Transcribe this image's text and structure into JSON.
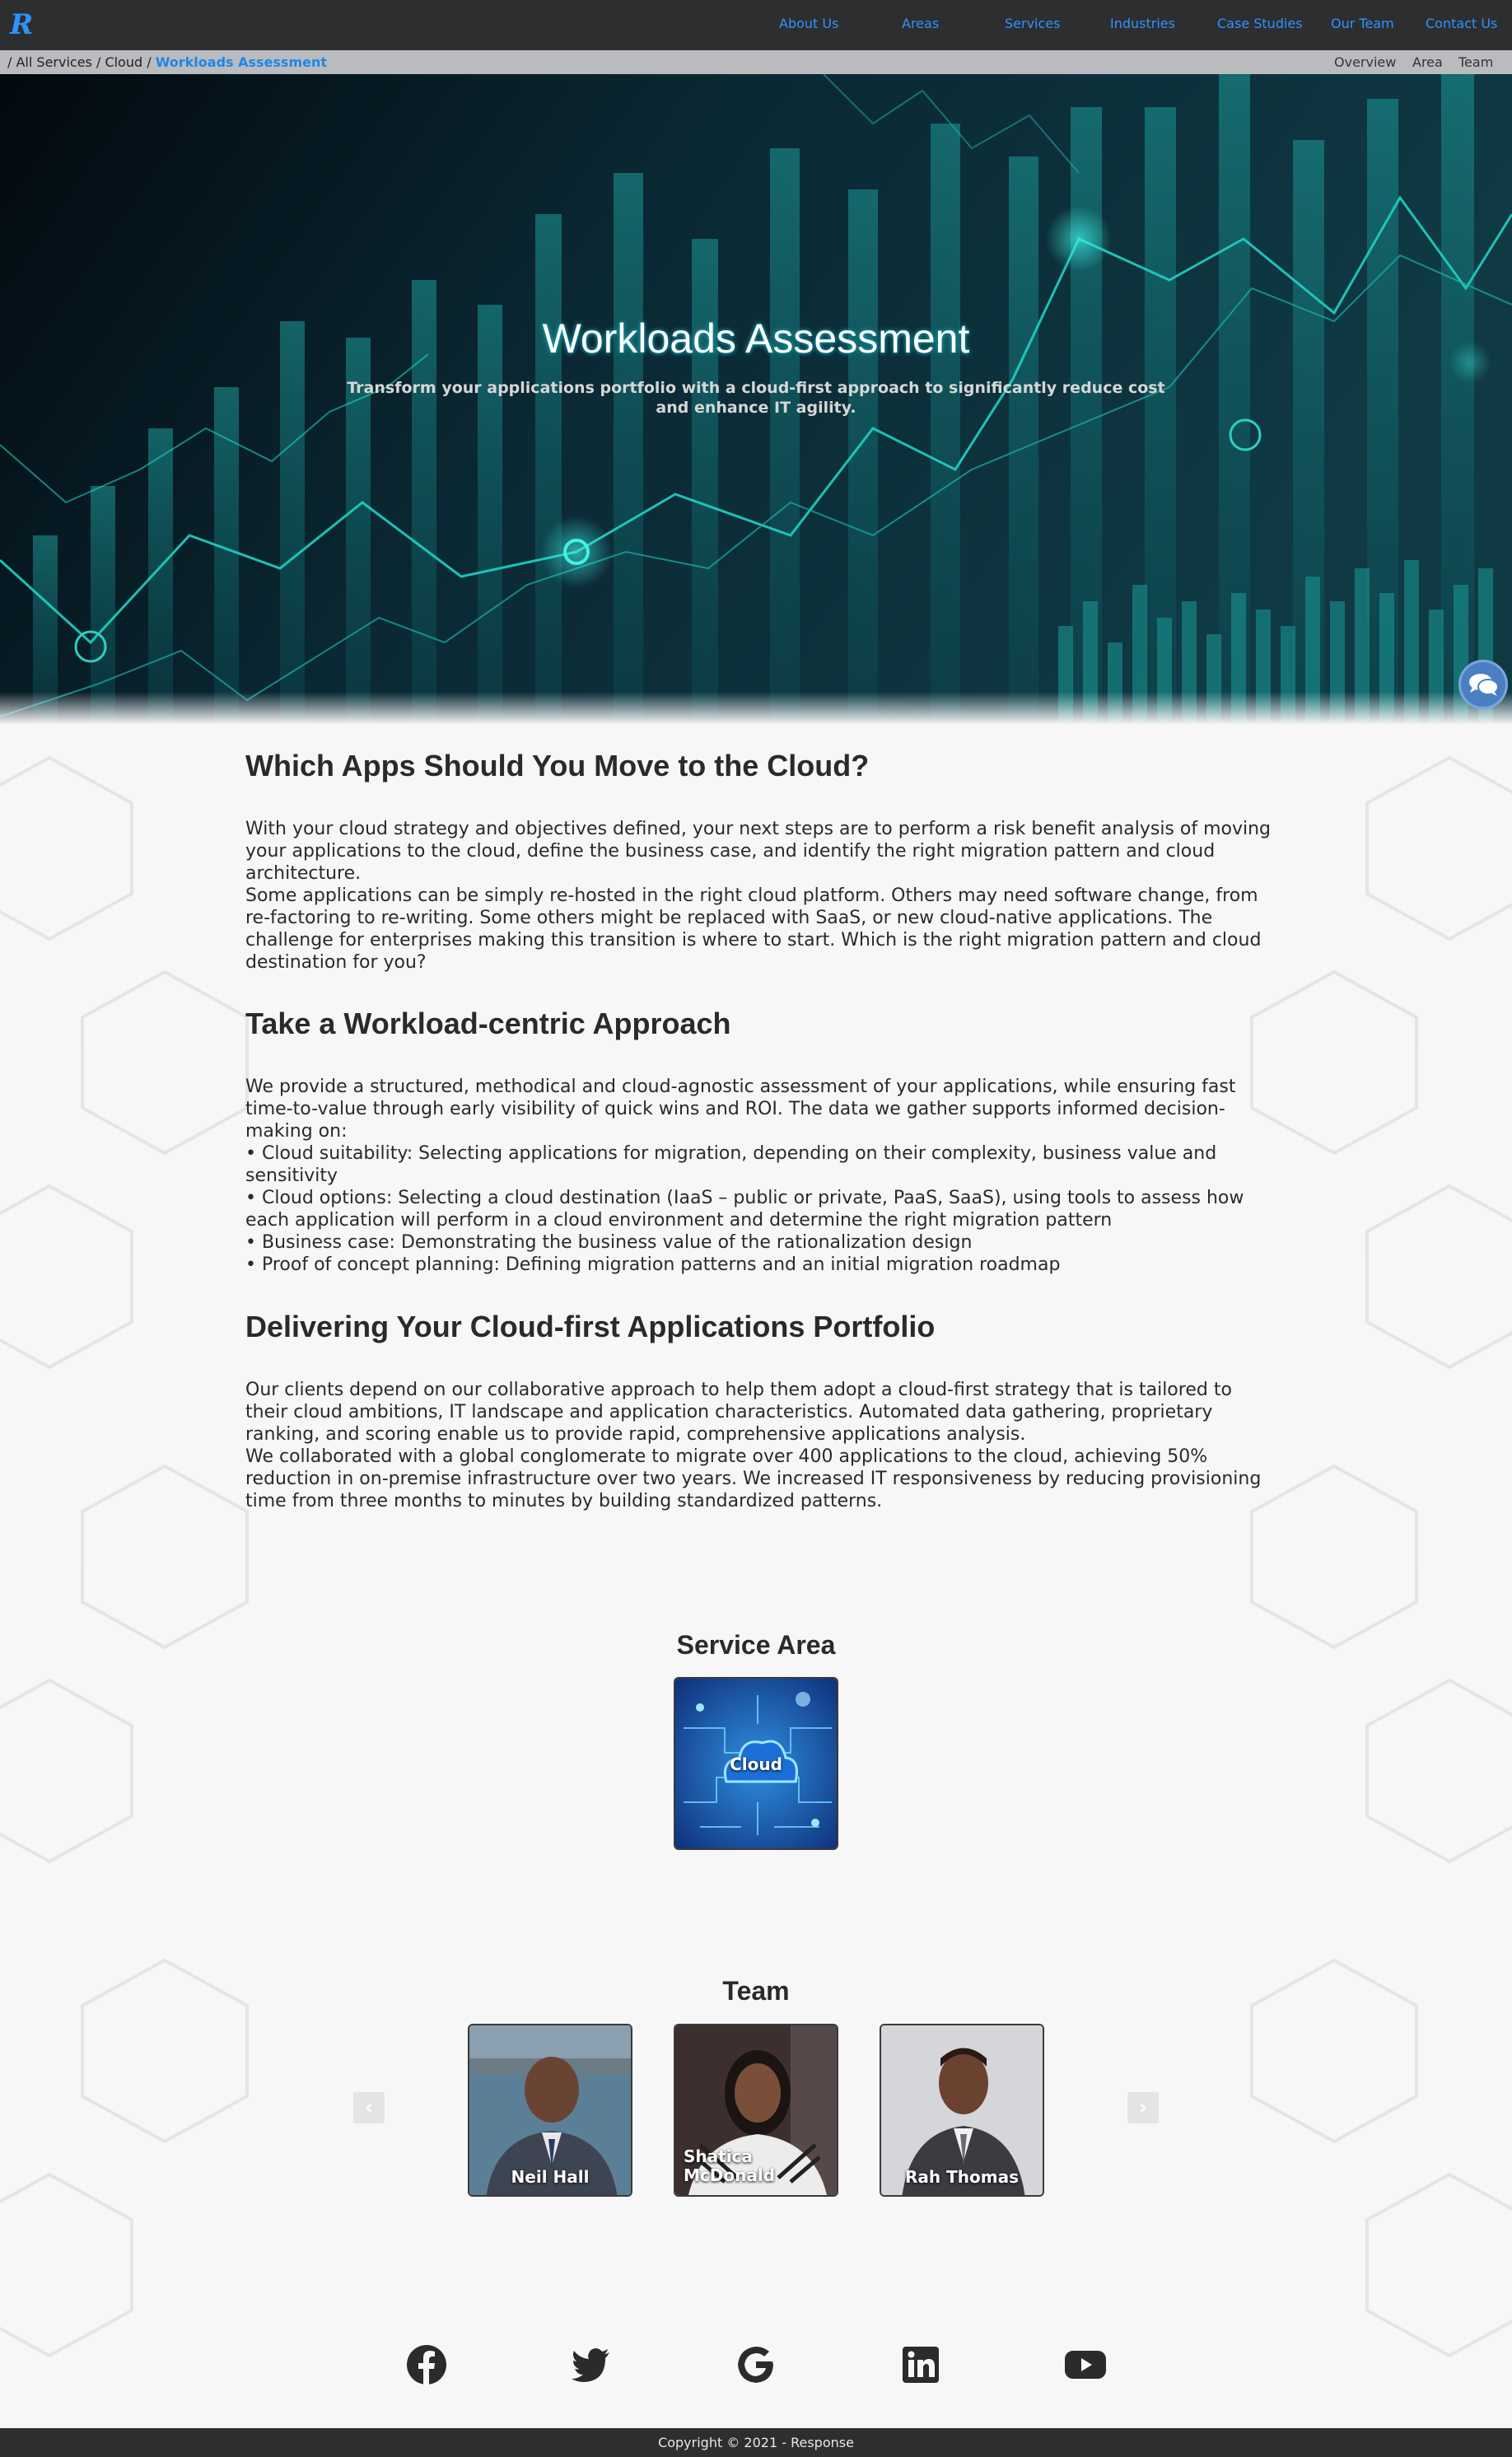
{
  "nav": {
    "logo": "R",
    "links": [
      "About Us",
      "Areas",
      "Services",
      "Industries",
      "Case Studies",
      "Our Team",
      "Contact Us"
    ]
  },
  "breadcrumb": {
    "items": [
      "All Services",
      "Cloud"
    ],
    "current": "Workloads Assessment",
    "anchors": [
      "Overview",
      "Area",
      "Team"
    ]
  },
  "hero": {
    "title": "Workloads Assessment",
    "subtitle": "Transform your applications portfolio with a cloud-first approach to significantly reduce cost and enhance IT agility."
  },
  "sections": [
    {
      "heading": "Which Apps Should You Move to the Cloud?",
      "paragraphs": [
        "With your cloud strategy and objectives defined, your next steps are to perform a risk benefit analysis of moving your applications to the cloud, define the business case, and identify the right migration pattern and cloud architecture.",
        "Some applications can be simply re-hosted in the right cloud platform. Others may need software change, from re-factoring to re-writing. Some others might be replaced with SaaS, or new cloud-native applications. The challenge for enterprises making this transition is where to start. Which is the right migration pattern and cloud destination for you?"
      ]
    },
    {
      "heading": "Take a Workload-centric Approach",
      "paragraphs": [
        "We provide a structured, methodical and cloud-agnostic assessment of your applications, while ensuring fast time-to-value through early visibility of quick wins and ROI. The data we gather supports informed decision-making on:",
        "• Cloud suitability: Selecting applications for migration, depending on their complexity, business value and sensitivity",
        "• Cloud options: Selecting a cloud destination (IaaS – public or private, PaaS, SaaS), using tools to assess how each application will perform in a cloud environment and determine the right migration pattern",
        "• Business case: Demonstrating the business value of the rationalization design",
        "• Proof of concept planning: Defining migration patterns and an initial migration roadmap"
      ]
    },
    {
      "heading": "Delivering Your Cloud-first Applications Portfolio",
      "paragraphs": [
        "Our clients depend on our collaborative approach to help them adopt a cloud-first strategy that is tailored to their cloud ambitions, IT landscape and application characteristics. Automated data gathering, proprietary ranking, and scoring enable us to provide rapid, comprehensive applications analysis.",
        "We collaborated with a global conglomerate to migrate over 400 applications to the cloud, achieving 50% reduction in on-premise infrastructure over two years. We increased IT responsiveness by reducing provisioning time from three months to minutes by building standardized patterns."
      ]
    }
  ],
  "service_area": {
    "title": "Service Area",
    "tiles": [
      "Cloud"
    ]
  },
  "team": {
    "title": "Team",
    "members": [
      "Neil Hall",
      "Shatica McDonald",
      "Rah Thomas"
    ]
  },
  "social": {
    "icons": [
      "facebook-icon",
      "twitter-icon",
      "google-icon",
      "linkedin-icon",
      "youtube-icon"
    ]
  },
  "footer": {
    "copyright": "Copyright © 2021 - Response"
  },
  "colors": {
    "accent": "#2e93ff",
    "breadcrumb_current": "#1e86e8",
    "nav_bg": "#2d2e30",
    "hero_glow": "#1fb9c9"
  }
}
